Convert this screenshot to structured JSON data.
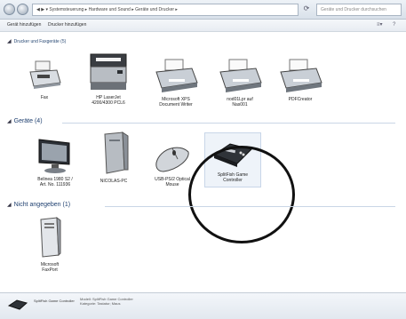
{
  "window": {
    "breadcrumb": "◀ ▶ ▾  Systemsteuerung ▸ Hardware und Sound ▸ Geräte und Drucker ▸",
    "search_placeholder": "Geräte und Drucker durchsuchen"
  },
  "toolbar": {
    "add_device": "Gerät hinzufügen",
    "add_printer": "Drucker hinzufügen"
  },
  "sections": {
    "printers_header": "Drucker und Faxgeräte (5)",
    "devices_header": "Geräte (4)",
    "unspecified_header": "Nicht angegeben (1)"
  },
  "printers": [
    {
      "label": "Fax",
      "icon": "fax-icon"
    },
    {
      "label": "HP LaserJet\n4200/4300 PCL6",
      "icon": "laser-printer-icon"
    },
    {
      "label": "Microsoft XPS\nDocument Writer",
      "icon": "printer-icon"
    },
    {
      "label": "nod01Lpr auf\nNas001",
      "icon": "printer-icon"
    },
    {
      "label": "PDFCreator",
      "icon": "printer-icon"
    }
  ],
  "devices": [
    {
      "label": "Belinea 1980 S2 /\nArt. No. 111936",
      "icon": "monitor-icon"
    },
    {
      "label": "NICOLAS-PC",
      "icon": "computer-tower-icon"
    },
    {
      "label": "USB-PS/2 Optical\nMouse",
      "icon": "mouse-icon"
    },
    {
      "label": "SplitFish Game\nController",
      "icon": "game-controller-icon"
    }
  ],
  "unspecified": [
    {
      "label": "Microsoft\nFaxPort",
      "icon": "pc-tower-icon"
    }
  ],
  "details": {
    "name": "SplitFish Game Controller",
    "meta": "Modell: SplitFish Game Controller\nKategorie: Tastatur; Maus"
  }
}
